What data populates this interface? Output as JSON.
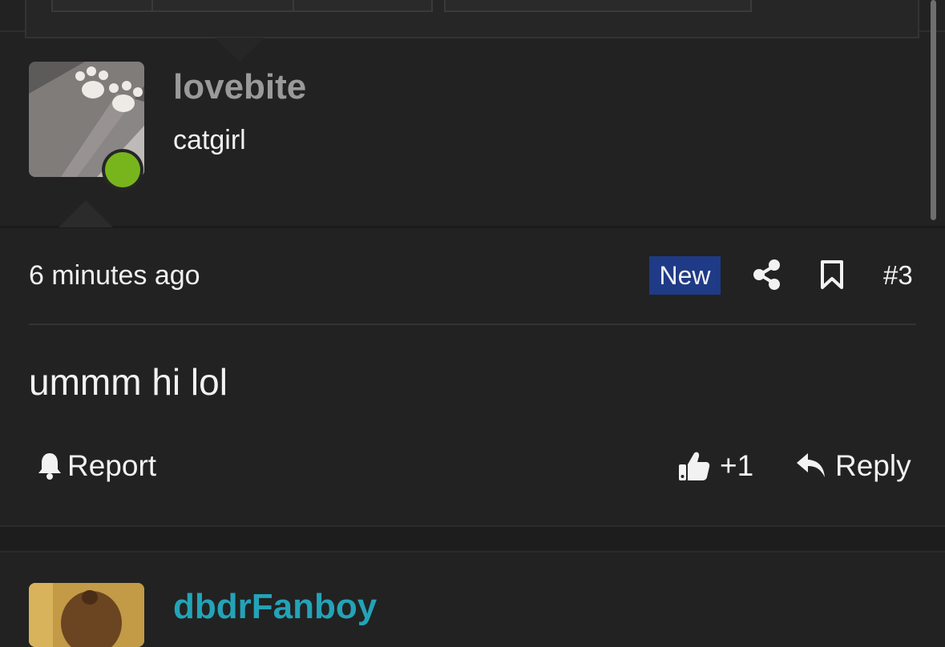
{
  "post": {
    "author": {
      "username": "lovebite",
      "title": "catgirl",
      "online": true
    },
    "time": "6 minutes ago",
    "badge": "New",
    "number": "#3",
    "message": "ummm hi lol",
    "actions": {
      "report": "Report",
      "like_count": "+1",
      "reply": "Reply"
    }
  },
  "next_post": {
    "username": "dbdrFanboy"
  },
  "colors": {
    "background": "#222222",
    "new_badge": "#1f3a86",
    "online_dot": "#78b51d",
    "username_next": "#23a3b8"
  },
  "icons": [
    "share-icon",
    "bookmark-icon",
    "bell-icon",
    "thumbs-up-icon",
    "reply-icon"
  ]
}
